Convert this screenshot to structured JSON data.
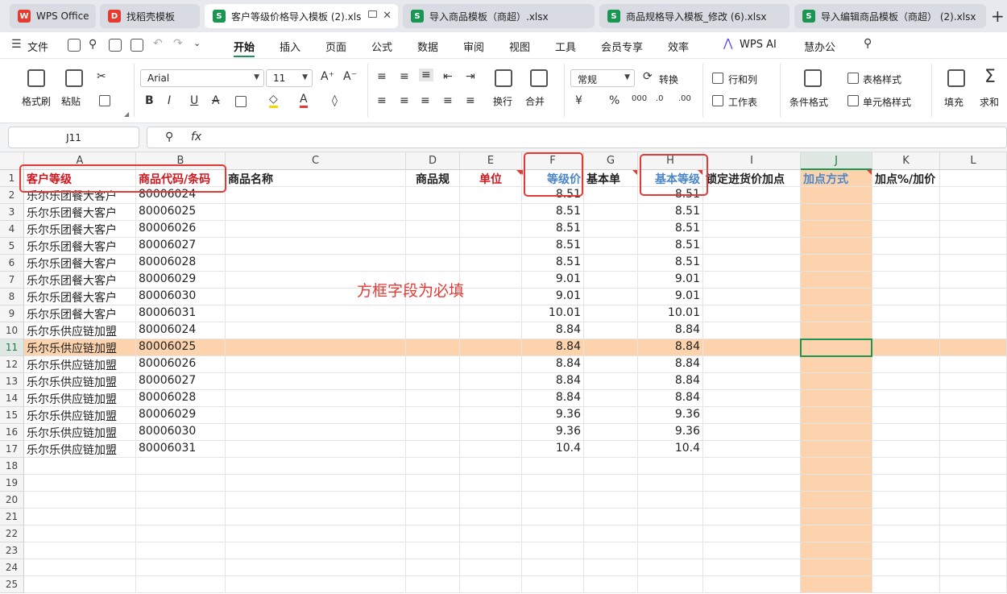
{
  "tabs": [
    {
      "label": "WPS Office",
      "icon": "wps-logo-icon"
    },
    {
      "label": "找稻壳模板",
      "icon": "docer-icon"
    },
    {
      "label": "客户等级价格导入模板 (2).xls",
      "icon": "spreadsheet-icon"
    },
    {
      "label": "导入商品模板（商超）.xlsx",
      "icon": "spreadsheet-icon"
    },
    {
      "label": "商品规格导入模板_修改 (6).xlsx",
      "icon": "spreadsheet-icon"
    },
    {
      "label": "导入编辑商品模板（商超） (2).xlsx",
      "icon": "spreadsheet-icon"
    }
  ],
  "menu": {
    "file": "文件",
    "items": [
      "开始",
      "插入",
      "页面",
      "公式",
      "数据",
      "审阅",
      "视图",
      "工具",
      "会员专享",
      "效率",
      "WPS AI",
      "慧办公"
    ]
  },
  "ribbon": {
    "format_painter": "格式刷",
    "paste": "粘贴",
    "font": "Arial",
    "font_size": "11",
    "wrap": "换行",
    "merge": "合并",
    "number_format": "常规",
    "convert": "转换",
    "row_col": "行和列",
    "worksheet": "工作表",
    "cond_format": "条件格式",
    "table_style": "表格样式",
    "cell_style": "单元格样式",
    "fill": "填充",
    "sum": "求和"
  },
  "formula_bar": {
    "name_box": "J11",
    "fx": "fx"
  },
  "columns": [
    "A",
    "B",
    "C",
    "D",
    "E",
    "F",
    "G",
    "H",
    "I",
    "J",
    "K",
    "L"
  ],
  "headers": {
    "A": "客户等级",
    "B": "商品代码/条码",
    "C": "商品名称",
    "D": "商品规",
    "E": "单位",
    "F": "等级价",
    "G": "基本单",
    "H": "基本等级",
    "I": "锁定进货价加点",
    "J": "加点方式",
    "K": "加点%/加价"
  },
  "rows": [
    [
      "乐尔乐团餐大客户",
      "80006024",
      "8.51",
      "8.51"
    ],
    [
      "乐尔乐团餐大客户",
      "80006025",
      "8.51",
      "8.51"
    ],
    [
      "乐尔乐团餐大客户",
      "80006026",
      "8.51",
      "8.51"
    ],
    [
      "乐尔乐团餐大客户",
      "80006027",
      "8.51",
      "8.51"
    ],
    [
      "乐尔乐团餐大客户",
      "80006028",
      "8.51",
      "8.51"
    ],
    [
      "乐尔乐团餐大客户",
      "80006029",
      "9.01",
      "9.01"
    ],
    [
      "乐尔乐团餐大客户",
      "80006030",
      "9.01",
      "9.01"
    ],
    [
      "乐尔乐团餐大客户",
      "80006031",
      "10.01",
      "10.01"
    ],
    [
      "乐尔乐供应链加盟",
      "80006024",
      "8.84",
      "8.84"
    ],
    [
      "乐尔乐供应链加盟",
      "80006025",
      "8.84",
      "8.84"
    ],
    [
      "乐尔乐供应链加盟",
      "80006026",
      "8.84",
      "8.84"
    ],
    [
      "乐尔乐供应链加盟",
      "80006027",
      "8.84",
      "8.84"
    ],
    [
      "乐尔乐供应链加盟",
      "80006028",
      "8.84",
      "8.84"
    ],
    [
      "乐尔乐供应链加盟",
      "80006029",
      "9.36",
      "9.36"
    ],
    [
      "乐尔乐供应链加盟",
      "80006030",
      "9.36",
      "9.36"
    ],
    [
      "乐尔乐供应链加盟",
      "80006031",
      "10.4",
      "10.4"
    ]
  ],
  "visible_rows": 25,
  "annotation": "方框字段为必填",
  "colors": {
    "accent": "#1a9652",
    "highlight": "#fcd3ad",
    "required_red": "#d0171e",
    "header_blue": "#4a86c8",
    "box_red": "#e53935"
  }
}
